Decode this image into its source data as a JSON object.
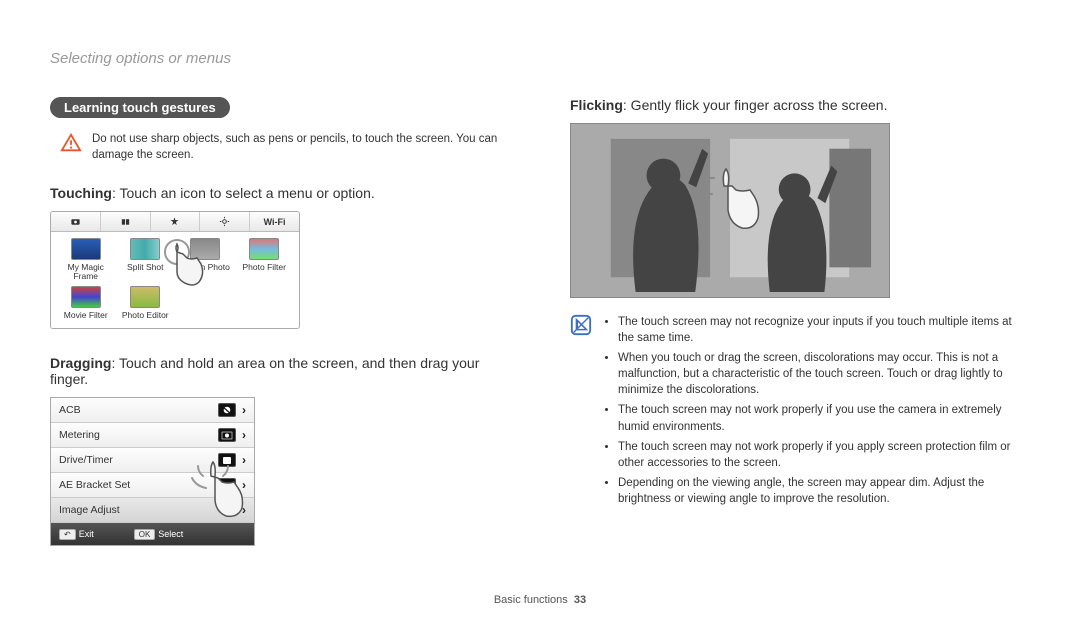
{
  "header": "Selecting options or menus",
  "pill": "Learning touch gestures",
  "warning": "Do not use sharp objects, such as pens or pencils, to touch the screen. You can damage the screen.",
  "touching": {
    "bold": "Touching",
    "rest": ": Touch an icon to select a menu or option."
  },
  "dragging": {
    "bold": "Dragging",
    "rest": ": Touch and hold an area on the screen, and then drag your finger."
  },
  "flicking": {
    "bold": "Flicking",
    "rest": ": Gently flick your finger across the screen."
  },
  "app": {
    "wifi_tab": "Wi-Fi",
    "items": [
      {
        "label": "My Magic Frame"
      },
      {
        "label": "Split Shot"
      },
      {
        "label": "Motion Photo"
      },
      {
        "label": "Photo Filter"
      },
      {
        "label": "Movie Filter"
      },
      {
        "label": "Photo Editor"
      }
    ]
  },
  "list": {
    "rows": [
      "ACB",
      "Metering",
      "Drive/Timer",
      "AE Bracket Set",
      "Image Adjust"
    ],
    "footer_exit_key": "↶",
    "footer_exit": "Exit",
    "footer_select_key": "OK",
    "footer_select": "Select"
  },
  "info_bullets": [
    "The touch screen may not recognize your inputs if you touch multiple items at the same time.",
    "When you touch or drag the screen, discolorations may occur. This is not a malfunction, but a characteristic of the touch screen. Touch or drag lightly to minimize the discolorations.",
    "The touch screen may not work properly if you use the camera in extremely humid environments.",
    "The touch screen may not work properly if you apply screen protection film or other accessories to the screen.",
    "Depending on the viewing angle, the screen may appear dim. Adjust the brightness or viewing angle to improve the resolution."
  ],
  "footer": {
    "section": "Basic functions",
    "page": "33"
  }
}
